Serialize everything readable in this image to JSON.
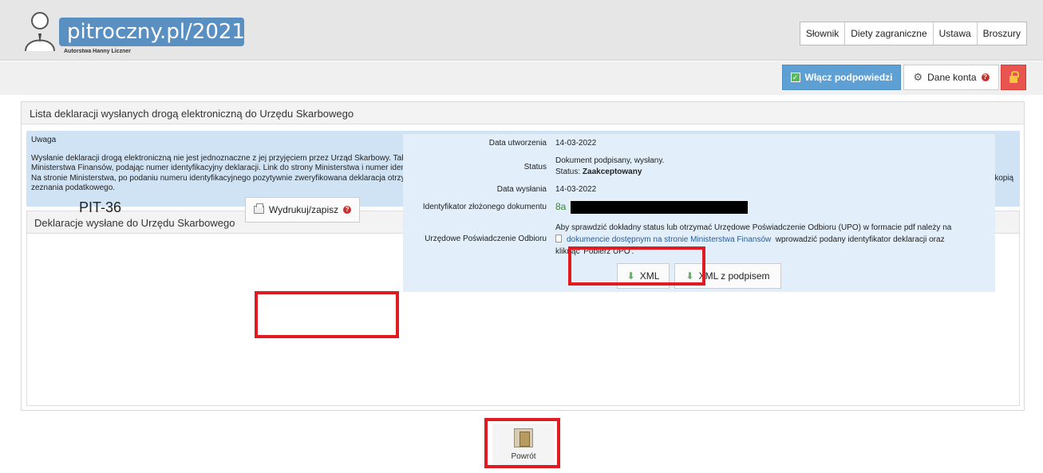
{
  "header": {
    "logo_text": "pitroczny.pl/2021",
    "logo_subtitle": "Autorstwa Hanny Liczner",
    "nav": [
      {
        "label": "Słownik"
      },
      {
        "label": "Diety zagraniczne"
      },
      {
        "label": "Ustawa"
      },
      {
        "label": "Broszury"
      }
    ]
  },
  "toolbar": {
    "hints_label": "Włącz podpowiedzi",
    "account_label": "Dane konta"
  },
  "panel": {
    "title": "Lista deklaracji wysłanych drogą elektroniczną do Urzędu Skarbowego",
    "notice": {
      "title": "Uwaga",
      "line1": "Wysłanie deklaracji drogą elektroniczną nie jest jednoznaczne z jej przyjęciem przez Urząd Skarbowy. Taką pewność uzyskuje się dopiero wówczas, gdy deklaracja otrzyma status: \"Przetwarzanie dokumentu zakończone poprawnie\". Status można sprawdzić na stronie Ministerstwa Finansów, podając numer identyfikacyjny deklaracji. Link do strony Ministerstwa i numer identyfikacyjny wysłanej deklaracji będzie dostępny w serwisie w zakładce PIT-y.",
      "line2": "Na stronie Ministerstwa, po podaniu numeru identyfikacyjnego pozytywnie zweryfikowana deklaracja otrzyma dokument UPO (Urzędowe poświadczenie odbioru). UPO jest właściwym dowodem, że deklaracja została przyjęta. Należy go wydrukować i przechowywać wraz z kopią zeznania podatkowego."
    },
    "sub_title": "Deklaracje wysłane do Urzędu Skarbowego"
  },
  "declaration": {
    "form": "PIT-36",
    "print_label": "Wydrukuj/zapisz",
    "created_label": "Data utworzenia",
    "created_value": "14-03-2022",
    "status_label": "Status",
    "status_line1": "Dokument podpisany, wysłany.",
    "status_prefix": "Status:",
    "status_value": "Zaakceptowany",
    "sent_label": "Data wysłania",
    "sent_value": "14-03-2022",
    "id_label": "Identyfikator złożonego dokumentu",
    "id_value": "8a",
    "upo_label": "Urzędowe Poświadczenie Odbioru",
    "upo_text1": "Aby sprawdzić dokładny status lub otrzymać Urzędowe Poświadczenie Odbioru (UPO) w formacie pdf należy na",
    "upo_link": "dokumencie dostępnym na stronie Ministerstwa Finansów",
    "upo_text2": "wprowadzić podany identyfikator deklaracji oraz",
    "upo_text3": "kliknąć 'Pobierz UPO'.",
    "xml_label": "XML",
    "xml_signed_label": "XML z podpisem"
  },
  "footer": {
    "back_label": "Powrót"
  },
  "colors": {
    "accent": "#5ea0d4",
    "highlight": "#e11b22",
    "status_green": "#2e8b2e"
  }
}
